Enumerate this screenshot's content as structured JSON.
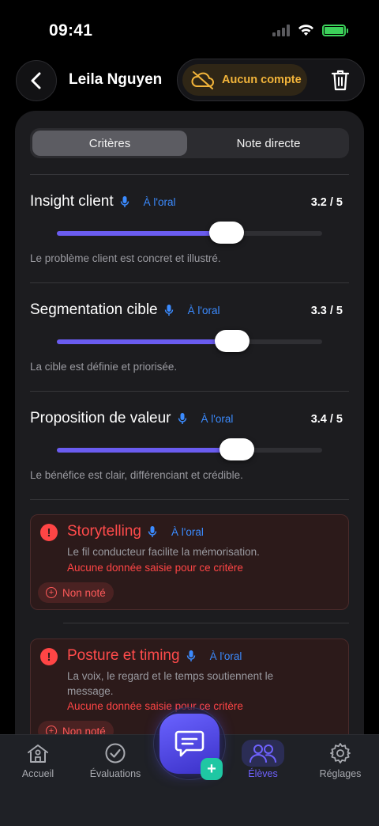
{
  "status_bar": {
    "time": "09:41"
  },
  "header": {
    "student_name": "Leila Nguyen",
    "account_label": "Aucun compte"
  },
  "tabs": {
    "criteria": "Critères",
    "direct": "Note directe"
  },
  "criteria": [
    {
      "title": "Insight client",
      "oral": "À l'oral",
      "score": "3.2 / 5",
      "value": 3.2,
      "description": "Le problème client est concret et illustré."
    },
    {
      "title": "Segmentation cible",
      "oral": "À l'oral",
      "score": "3.3 / 5",
      "value": 3.3,
      "description": "La cible est définie et priorisée."
    },
    {
      "title": "Proposition de valeur",
      "oral": "À l'oral",
      "score": "3.4 / 5",
      "value": 3.4,
      "description": "Le bénéfice est clair, différenciant et crédible."
    }
  ],
  "unscored": [
    {
      "title": "Storytelling",
      "oral": "À l'oral",
      "description": "Le fil conducteur facilite la mémorisation.",
      "warning": "Aucune donnée saisie pour ce critère",
      "badge": "Non noté"
    },
    {
      "title": "Posture et timing",
      "oral": "À l'oral",
      "description": "La voix, le regard et le temps soutiennent le message.",
      "warning": "Aucune donnée saisie pour ce critère",
      "badge": "Non noté"
    }
  ],
  "tabbar": {
    "home": "Accueil",
    "evaluations": "Évaluations",
    "students": "Élèves",
    "settings": "Réglages"
  },
  "colors": {
    "accent": "#6a5cf0",
    "warning": "#ff4545",
    "account": "#f2b43a",
    "oral": "#3b8bff"
  }
}
